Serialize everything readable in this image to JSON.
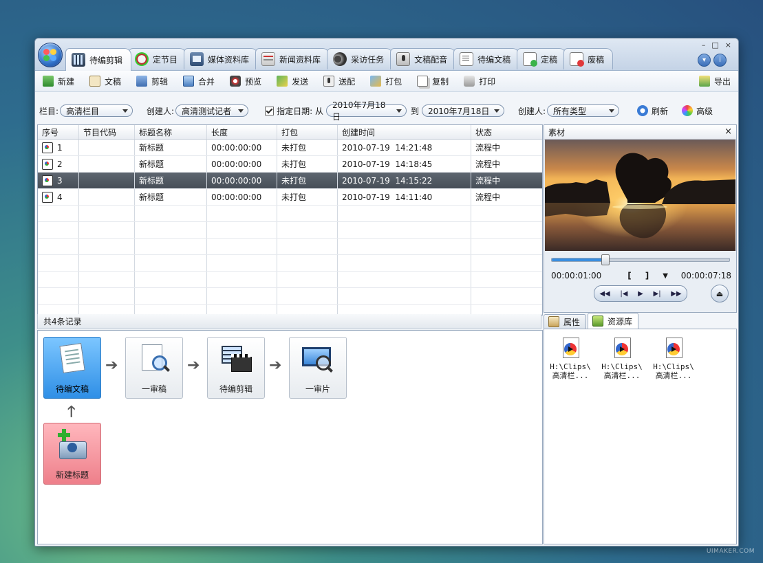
{
  "window": {
    "tabs": [
      {
        "label": "待编剪辑",
        "icon": "film-edit-icon",
        "active": true
      },
      {
        "label": "定节目",
        "icon": "program-check-icon"
      },
      {
        "label": "媒体资料库",
        "icon": "media-library-icon"
      },
      {
        "label": "新闻资料库",
        "icon": "news-library-icon"
      },
      {
        "label": "采访任务",
        "icon": "camera-task-icon"
      },
      {
        "label": "文稿配音",
        "icon": "voice-over-icon"
      },
      {
        "label": "待编文稿",
        "icon": "pending-script-icon"
      },
      {
        "label": "定稿",
        "icon": "final-draft-icon"
      },
      {
        "label": "废稿",
        "icon": "discard-draft-icon"
      }
    ],
    "controls": {
      "minimize": "–",
      "maximize": "□",
      "close": "×"
    }
  },
  "toolbar": {
    "items": [
      {
        "label": "新建",
        "icon": "new-icon"
      },
      {
        "label": "文稿",
        "icon": "script-icon"
      },
      {
        "label": "剪辑",
        "icon": "edit-icon"
      },
      {
        "label": "合并",
        "icon": "merge-icon"
      },
      {
        "label": "预览",
        "icon": "preview-icon"
      },
      {
        "label": "发送",
        "icon": "send-icon"
      },
      {
        "label": "送配",
        "icon": "dub-icon"
      },
      {
        "label": "打包",
        "icon": "package-icon"
      },
      {
        "label": "复制",
        "icon": "copy-icon"
      },
      {
        "label": "打印",
        "icon": "print-icon"
      }
    ],
    "export_label": "导出"
  },
  "filter": {
    "column_label": "栏目:",
    "column_value": "高清栏目",
    "creator_label": "创建人:",
    "creator_value": "高清测试记者",
    "date_label": "指定日期: 从",
    "date_from": "2010年7月18日",
    "date_to_label": "到",
    "date_to": "2010年7月18日",
    "creator2_label": "创建人:",
    "type_value": "所有类型",
    "refresh_label": "刷新",
    "advanced_label": "高级"
  },
  "grid": {
    "headers": [
      "序号",
      "节目代码",
      "标题名称",
      "长度",
      "打包",
      "创建时间",
      "状态"
    ],
    "rows": [
      {
        "no": "1",
        "code": "",
        "title": "新标题",
        "length": "00:00:00:00",
        "pack": "未打包",
        "created": "2010-07-19  14:21:48",
        "status": "流程中"
      },
      {
        "no": "2",
        "code": "",
        "title": "新标题",
        "length": "00:00:00:00",
        "pack": "未打包",
        "created": "2010-07-19  14:18:45",
        "status": "流程中"
      },
      {
        "no": "3",
        "code": "",
        "title": "新标题",
        "length": "00:00:00:00",
        "pack": "未打包",
        "created": "2010-07-19  14:15:22",
        "status": "流程中",
        "selected": true
      },
      {
        "no": "4",
        "code": "",
        "title": "新标题",
        "length": "00:00:00:00",
        "pack": "未打包",
        "created": "2010-07-19  14:11:40",
        "status": "流程中"
      }
    ],
    "footer": "共4条记录"
  },
  "workflow": {
    "nodes": [
      "待编文稿",
      "一审稿",
      "待编剪辑",
      "一审片",
      "新建标题"
    ]
  },
  "material": {
    "title": "素材",
    "close": "×",
    "time_in": "00:00:01:00",
    "time_out": "00:00:07:18",
    "mark_in": "[",
    "mark_out": "]",
    "progress": 0.3,
    "transport": [
      "◀◀",
      "|◀",
      "▶",
      "▶|",
      "▶▶"
    ],
    "eject": "⏏"
  },
  "right_tabs": [
    {
      "label": "属性",
      "active": false
    },
    {
      "label": "资源库",
      "active": true
    }
  ],
  "assets": [
    {
      "line1": "H:\\Clips\\",
      "line2": "高清栏..."
    },
    {
      "line1": "H:\\Clips\\",
      "line2": "高清栏..."
    },
    {
      "line1": "H:\\Clips\\",
      "line2": "高清栏..."
    }
  ],
  "watermark": "UIMAKER.COM"
}
